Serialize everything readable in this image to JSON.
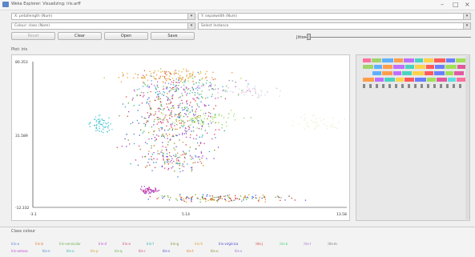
{
  "window": {
    "title": "Weka Explorer: Visualizing: iris.arff",
    "controls": [
      "–",
      "□",
      "×"
    ]
  },
  "controls": {
    "x_combo": "X: petallength (Num)",
    "y_combo": "Y: sepalwidth (Num)",
    "colour_combo": "Colour: class (Nom)",
    "select_combo": "Select Instance",
    "buttons": {
      "reset": "Reset",
      "clear": "Clear",
      "open": "Open",
      "save": "Save"
    },
    "jitter_label": "Jitter"
  },
  "plot": {
    "section_label": "Plot: iris",
    "y_ticks": [
      "80.353",
      "31.589",
      "-12.332"
    ],
    "x_ticks": [
      "-3.1",
      "5.14",
      "13.58"
    ]
  },
  "class_panel": {
    "label": "Class colour",
    "row1": [
      "Iris-a",
      "Iris-b",
      "Iris-versicolor",
      "Iris-d",
      "Iris-e",
      "Iris-f",
      "Iris-g",
      "Iris-h",
      "Iris-virginica",
      "Iris-j",
      "Iris-k",
      "Iris-l",
      "Iris-m"
    ],
    "row2": [
      "Iris-setosa",
      "Iris-n",
      "Iris-o",
      "Iris-p",
      "Iris-q",
      "Iris-r",
      "Iris-s",
      "Iris-t",
      "Iris-u",
      "Iris-v"
    ]
  },
  "colors": {
    "legend_bars": [
      "#ff6fa0",
      "#9fd46a",
      "#5fb0ff",
      "#ff9e4a",
      "#c06fff",
      "#4ad4c0",
      "#ffd24a",
      "#ff5a5a",
      "#6a7fff",
      "#a0e05a",
      "#e05aa0",
      "#5ae0e0"
    ],
    "chips_row1": [
      "#4a7fd4",
      "#e07a2a",
      "#6ab04a",
      "#c04ad4",
      "#d44a6a",
      "#2ab0b0",
      "#8a8a2a",
      "#d4a02a",
      "#4a4ad4",
      "#d42a2a",
      "#2ad46a",
      "#a06ad4",
      "#6a6a6a"
    ],
    "chips_row2": [
      "#c04ad4",
      "#4a7fd4",
      "#2ab0b0",
      "#d4a02a",
      "#6ab04a",
      "#d44a6a",
      "#4a4ad4",
      "#e07a2a",
      "#8a8a2a",
      "#a06ad4"
    ]
  }
}
